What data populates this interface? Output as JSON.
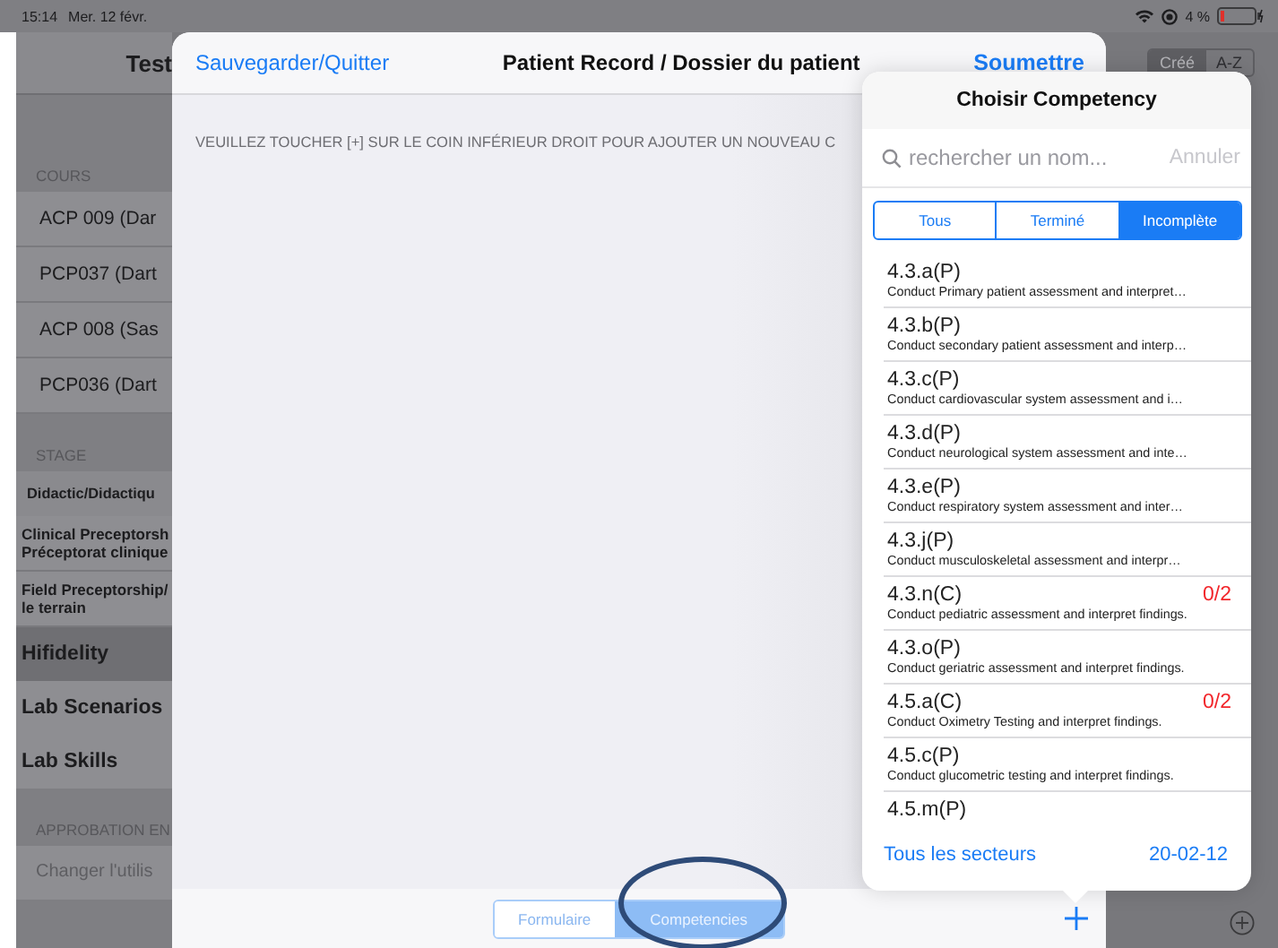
{
  "status_bar": {
    "time": "15:14",
    "date": "Mer. 12 févr.",
    "battery": "4 %"
  },
  "background": {
    "title": "Test",
    "sort_options": [
      {
        "label": "Créé",
        "selected": true
      },
      {
        "label": "A-Z",
        "selected": false
      }
    ],
    "sections": [
      {
        "header": "COURS",
        "items": [
          {
            "kind": "course",
            "lines": [
              "ACP 009 (Dar"
            ],
            "selected": false
          },
          {
            "kind": "course",
            "lines": [
              "PCP037 (Dart"
            ],
            "selected": false
          },
          {
            "kind": "course",
            "lines": [
              "ACP 008 (Sas"
            ],
            "selected": false
          },
          {
            "kind": "course",
            "lines": [
              "PCP036 (Dart"
            ],
            "selected": false
          }
        ]
      },
      {
        "header": "STAGE",
        "items": [
          {
            "kind": "stage",
            "lines": [
              "Didactic/Didactiqu"
            ],
            "selected": false
          },
          {
            "kind": "stage_small",
            "lines": [
              "Clinical Preceptorsh",
              "Préceptorat clinique"
            ],
            "selected": false
          },
          {
            "kind": "stage_small",
            "lines": [
              "Field Preceptorship/",
              "le terrain"
            ],
            "selected": false
          },
          {
            "kind": "category",
            "lines": [
              "Hifidelity"
            ],
            "selected": true
          },
          {
            "kind": "category",
            "lines": [
              "Lab Scenarios"
            ],
            "selected": false
          },
          {
            "kind": "category",
            "lines": [
              "Lab Skills"
            ],
            "selected": false
          }
        ]
      },
      {
        "header": "APPROBATION EN",
        "items": [
          {
            "kind": "action",
            "lines": [
              "Changer l'utilis"
            ],
            "selected": false
          }
        ]
      }
    ]
  },
  "modal": {
    "save": "Sauvegarder/Quitter",
    "title": "Patient Record / Dossier du patient",
    "submit": "Soumettre",
    "message": "VEUILLEZ TOUCHER [+] SUR LE COIN INFÉRIEUR DROIT POUR AJOUTER UN NOUVEAU C",
    "tabs": [
      {
        "label": "Formulaire",
        "selected": false
      },
      {
        "label": "Competencies",
        "selected": true
      }
    ]
  },
  "popover": {
    "title": "Choisir Competency",
    "search": {
      "placeholder": "rechercher un nom..."
    },
    "cancel": "Annuler",
    "filters": [
      {
        "label": "Tous",
        "selected": false
      },
      {
        "label": "Terminé",
        "selected": false
      },
      {
        "label": "Incomplète",
        "selected": true
      }
    ],
    "items": [
      {
        "code": "4.3.a(P)",
        "description": "Conduct Primary patient assessment and interpret…"
      },
      {
        "code": "4.3.b(P)",
        "description": "Conduct secondary patient assessment and interp…"
      },
      {
        "code": "4.3.c(P)",
        "description": "Conduct cardiovascular system assessment and i…"
      },
      {
        "code": "4.3.d(P)",
        "description": "Conduct neurological system assessment and inte…"
      },
      {
        "code": "4.3.e(P)",
        "description": "Conduct respiratory system assessment and inter…"
      },
      {
        "code": "4.3.j(P)",
        "description": "Conduct musculoskeletal assessment and interpr…"
      },
      {
        "code": "4.3.n(C)",
        "description": "Conduct pediatric assessment and interpret findings.",
        "count": "0/2"
      },
      {
        "code": "4.3.o(P)",
        "description": "Conduct geriatric assessment and interpret findings."
      },
      {
        "code": "4.5.a(C)",
        "description": "Conduct Oximetry Testing and interpret findings.",
        "count": "0/2"
      },
      {
        "code": "4.5.c(P)",
        "description": "Conduct glucometric testing and interpret findings."
      },
      {
        "code": "4.5.m(P)"
      }
    ],
    "footer_left": "Tous les secteurs",
    "footer_right": "20-02-12"
  }
}
